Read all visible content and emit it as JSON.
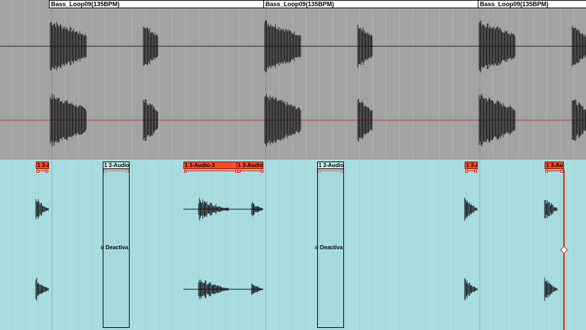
{
  "top_track": {
    "clips": [
      {
        "label": "Bass_Loop09(135BPM)"
      },
      {
        "label": "Bass_Loop09(135BPM)"
      },
      {
        "label": "Bass_Loop09(135BPM)"
      }
    ]
  },
  "bottom_track": {
    "red_clips": [
      {
        "label": "1 3-A"
      },
      {
        "label": "1 3-Audio-3"
      },
      {
        "label": "1 3-Audio"
      },
      {
        "label": "1 3-A"
      },
      {
        "label": "1 3-Au"
      }
    ],
    "deactivated_clips": [
      {
        "label": "1 3-Audio",
        "body_text": "o Deactiva"
      },
      {
        "label": "1 3-Audio",
        "body_text": "o Deactiva"
      }
    ]
  },
  "colors": {
    "top_track_bg": "#a3a3a3",
    "bottom_track_bg": "#a8dde0",
    "clip_active": "#ff4a2a",
    "playhead": "#e02010",
    "waveform": "#111111"
  }
}
